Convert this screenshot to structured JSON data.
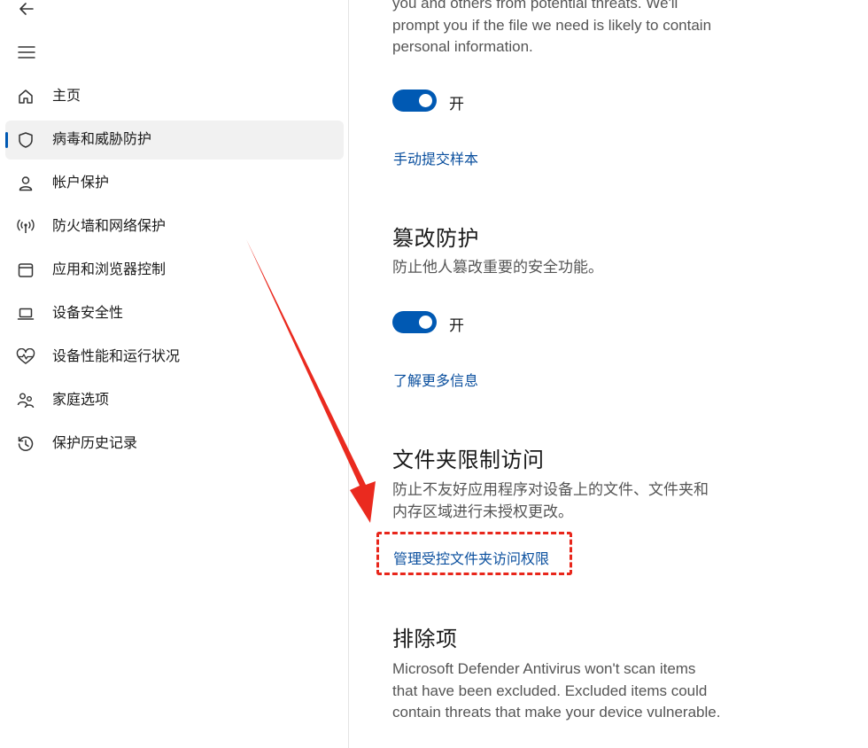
{
  "sidebar": {
    "items": [
      {
        "label": "主页",
        "icon": "home-icon"
      },
      {
        "label": "病毒和威胁防护",
        "icon": "shield-icon",
        "selected": true
      },
      {
        "label": "帐户保护",
        "icon": "person-icon"
      },
      {
        "label": "防火墙和网络保护",
        "icon": "wireless-icon"
      },
      {
        "label": "应用和浏览器控制",
        "icon": "browser-window-icon"
      },
      {
        "label": "设备安全性",
        "icon": "laptop-icon"
      },
      {
        "label": "设备性能和运行状况",
        "icon": "heart-pulse-icon"
      },
      {
        "label": "家庭选项",
        "icon": "family-icon"
      },
      {
        "label": "保护历史记录",
        "icon": "history-icon"
      }
    ]
  },
  "main": {
    "top_para": {
      "line1": "you and others from potential threats. We'll",
      "line2": "prompt you if the file we need is likely to contain",
      "line3": "personal information."
    },
    "sample_toggle": {
      "state": "开",
      "on": true
    },
    "submit_sample_link": "手动提交样本",
    "tamper": {
      "title": "篡改防护",
      "desc": "防止他人篡改重要的安全功能。",
      "toggle_state": "开",
      "on": true,
      "link": "了解更多信息"
    },
    "folder_access": {
      "title": "文件夹限制访问",
      "desc_line1": "防止不友好应用程序对设备上的文件、文件夹和",
      "desc_line2": "内存区域进行未授权更改。",
      "link": "管理受控文件夹访问权限"
    },
    "exclusions": {
      "title": "排除项",
      "line1": "Microsoft Defender Antivirus won't scan items",
      "line2": "that have been excluded. Excluded items could",
      "line3": "contain threats that make your device vulnerable."
    }
  },
  "colors": {
    "accent": "#0059b3",
    "link": "#0a4f9e",
    "annotation": "#e8261b"
  }
}
